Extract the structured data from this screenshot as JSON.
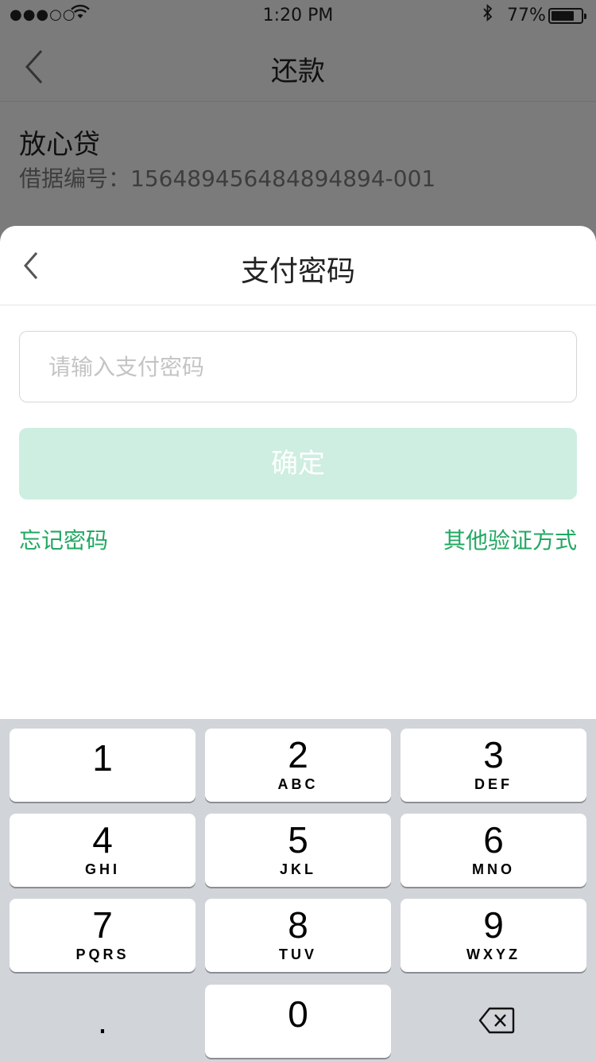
{
  "status_bar": {
    "signal": "●●●○○",
    "wifi_icon": "wifi-icon",
    "time": "1:20 PM",
    "bluetooth_icon": "bluetooth-icon",
    "battery_text": "77%",
    "battery_level": 0.77
  },
  "nav": {
    "title": "还款",
    "back_icon": "chevron-left-icon"
  },
  "loan": {
    "name": "放心贷",
    "number": "借据编号：156489456484894894-001"
  },
  "sheet": {
    "title": "支付密码",
    "back_icon": "chevron-left-icon",
    "password_placeholder": "请输入支付密码",
    "password_value": "",
    "confirm_label": "确定",
    "forgot_label": "忘记密码",
    "other_label": "其他验证方式",
    "accent_color": "#21a862",
    "confirm_bg": "#cdeee0"
  },
  "keypad": {
    "keys": [
      {
        "num": "1",
        "letters": ""
      },
      {
        "num": "2",
        "letters": "ABC"
      },
      {
        "num": "3",
        "letters": "DEF"
      },
      {
        "num": "4",
        "letters": "GHI"
      },
      {
        "num": "5",
        "letters": "JKL"
      },
      {
        "num": "6",
        "letters": "MNO"
      },
      {
        "num": "7",
        "letters": "PQRS"
      },
      {
        "num": "8",
        "letters": "TUV"
      },
      {
        "num": "9",
        "letters": "WXYZ"
      }
    ],
    "dot": ".",
    "zero": "0",
    "delete_icon": "backspace-icon"
  }
}
